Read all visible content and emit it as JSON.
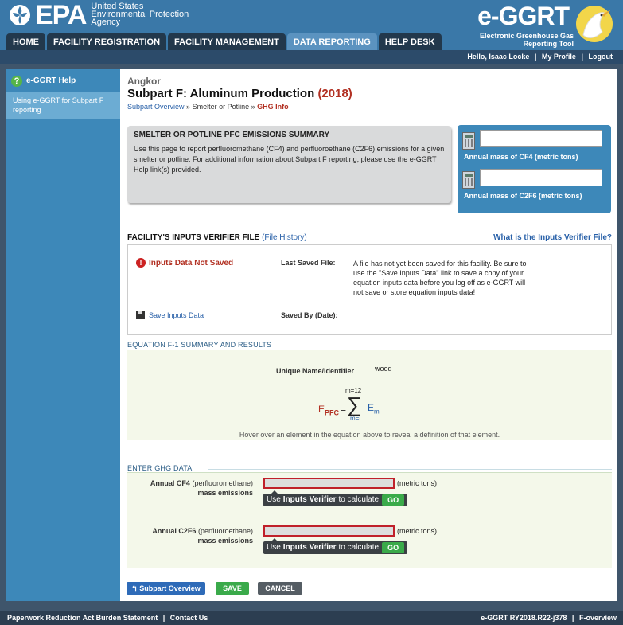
{
  "header": {
    "epa_wordmark": "EPA",
    "agency_lines": [
      "United States",
      "Environmental Protection",
      "Agency"
    ],
    "app_title": "e-GGRT",
    "app_subtitle": [
      "Electronic Greenhouse Gas",
      "Reporting Tool"
    ]
  },
  "nav": {
    "tabs": [
      {
        "label": "HOME",
        "active": false
      },
      {
        "label": "FACILITY REGISTRATION",
        "active": false
      },
      {
        "label": "FACILITY MANAGEMENT",
        "active": false
      },
      {
        "label": "DATA REPORTING",
        "active": true
      },
      {
        "label": "HELP DESK",
        "active": false
      }
    ]
  },
  "userbar": {
    "greeting": "Hello, Isaac Locke",
    "profile": "My Profile",
    "logout": "Logout"
  },
  "sidebar": {
    "help_title": "e-GGRT Help",
    "help_icon": "?",
    "item": "Using e-GGRT for Subpart F reporting"
  },
  "page": {
    "facility": "Angkor",
    "title": "Subpart F: Aluminum Production",
    "year": "(2018)",
    "breadcrumb": {
      "overview": "Subpart Overview",
      "sep": "»",
      "current": "Smelter or Potline",
      "ghg": "GHG Info"
    }
  },
  "summary": {
    "heading": "SMELTER OR POTLINE PFC EMISSIONS SUMMARY",
    "body": "Use this page to report perfluoromethane (CF4) and perfluoroethane (C2F6) emissions for a given smelter or potline. For additional information about Subpart F reporting, please use the e-GGRT Help link(s) provided."
  },
  "mass_panel": {
    "cf4_label": "Annual mass of CF4 (metric tons)",
    "c2f6_label": "Annual mass of C2F6 (metric tons)",
    "cf4_value": "",
    "c2f6_value": ""
  },
  "verifier": {
    "title": "FACILITY'S INPUTS VERIFIER FILE",
    "history_link": "(File History)",
    "help_link": "What is the Inputs Verifier File?",
    "status": "Inputs Data Not Saved",
    "last_saved_label": "Last Saved File:",
    "last_saved_msg": "A file has not yet been saved for this facility. Be sure to use the \"Save Inputs Data\" link to save a copy of your equation inputs data before you log off as e-GGRT will not save or store equation inputs data!",
    "save_link": "Save Inputs Data",
    "saved_by_label": "Saved By (Date):"
  },
  "equation": {
    "section_title": "EQUATION F-1 SUMMARY AND RESULTS",
    "uid_label": "Unique Name/Identifier",
    "uid_value": "wood",
    "lhs": "E",
    "lhs_sub": "PFC",
    "equals": "=",
    "sum_top": "m=12",
    "sum_bottom": "m=l",
    "sigma": "∑",
    "term": "E",
    "term_sub": "m",
    "hint": "Hover over an element in the equation above to reveal a definition of that element."
  },
  "ghg": {
    "section_title": "ENTER GHG DATA",
    "cf4": {
      "label_bold": "Annual CF4",
      "label_rest": "(perfluoromethane)",
      "label_line2": "mass emissions",
      "value": "",
      "unit": "(metric tons)"
    },
    "c2f6": {
      "label_bold": "Annual C2F6",
      "label_rest": "(perfluoroethane)",
      "label_line2": "mass emissions",
      "value": "",
      "unit": "(metric tons)"
    },
    "verifier_pre": "Use",
    "verifier_bold": "Inputs Verifier",
    "verifier_post": "to calculate",
    "go": "GO"
  },
  "buttons": {
    "overview": "Subpart Overview",
    "save": "SAVE",
    "cancel": "CANCEL"
  },
  "footer": {
    "paperwork": "Paperwork Reduction Act Burden Statement",
    "contact": "Contact Us",
    "version": "e-GGRT RY2018.R22-j378",
    "page_id": "F-overview"
  },
  "colors": {
    "header_blue": "#3a78a8",
    "active_tab": "#5b93c0",
    "accent_red": "#b23022",
    "link_blue": "#2860a8",
    "go_green": "#3aaa4a"
  }
}
